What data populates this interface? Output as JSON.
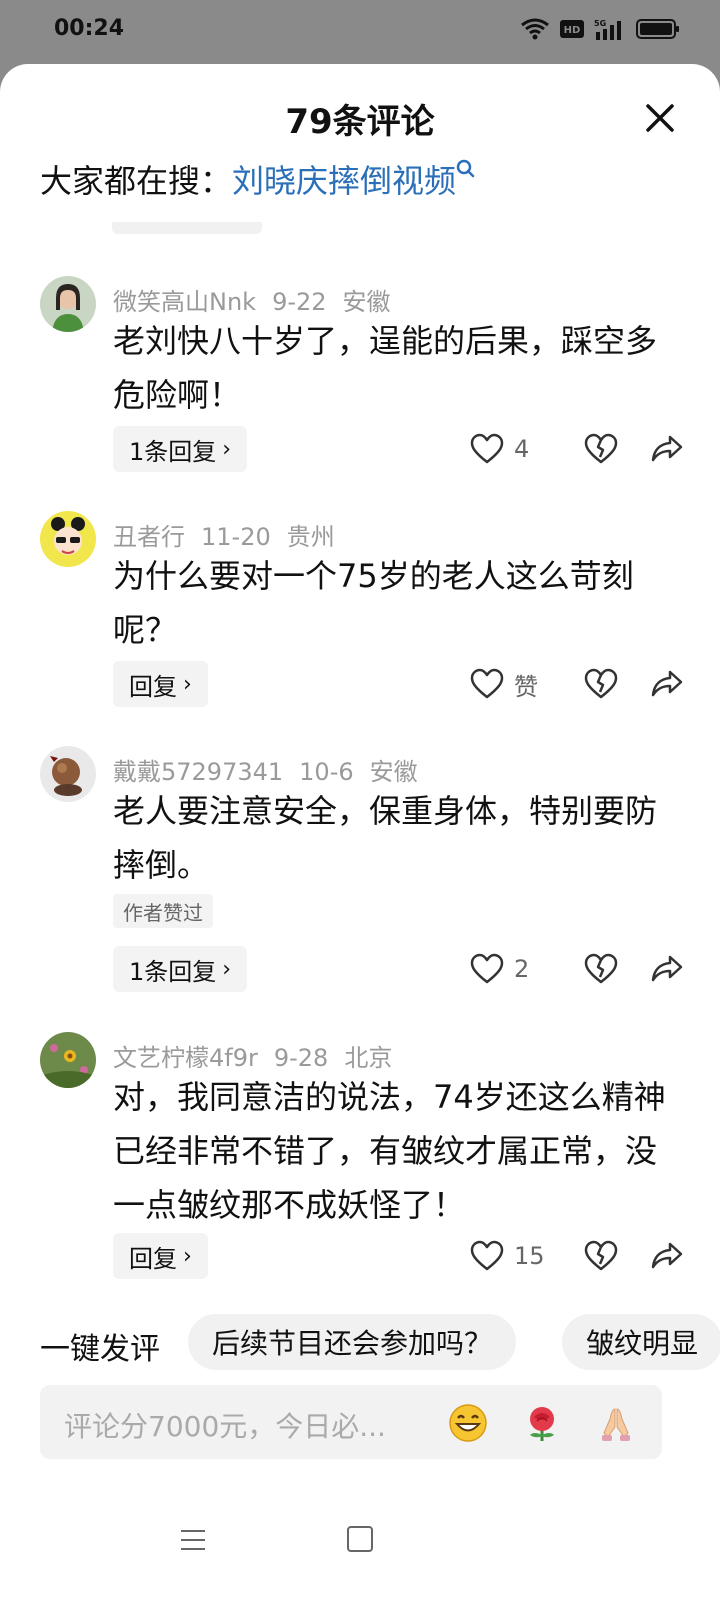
{
  "status": {
    "time": "00:24"
  },
  "sheet": {
    "title": "79条评论"
  },
  "search": {
    "label": "大家都在搜：",
    "query": "刘晓庆摔倒视频"
  },
  "comments": [
    {
      "user": "微笑高山Nnk",
      "date": "9-22",
      "location": "安徽",
      "text": "老刘快八十岁了，逞能的后果，踩空多危险啊！",
      "reply_label": "1条回复",
      "like_count": "4"
    },
    {
      "user": "丑者行",
      "date": "11-20",
      "location": "贵州",
      "text": "为什么要对一个75岁的老人这么苛刻呢？",
      "reply_label": "回复",
      "like_count": "赞"
    },
    {
      "user": "戴戴57297341",
      "date": "10-6",
      "location": "安徽",
      "text": "老人要注意安全，保重身体，特别要防摔倒。",
      "author_tag": "作者赞过",
      "reply_label": "1条回复",
      "like_count": "2"
    },
    {
      "user": "文艺柠檬4f9r",
      "date": "9-28",
      "location": "北京",
      "text": "对，我同意洁的说法，74岁还这么精神已经非常不错了，有皱纹才属正常，没一点皱纹那不成妖怪了！",
      "reply_label": "回复",
      "like_count": "15"
    }
  ],
  "quick_comments": {
    "label": "一键发评",
    "chips": [
      "后续节目还会参加吗？",
      "皱纹明显"
    ]
  },
  "input": {
    "placeholder": "评论分7000元，今日必..."
  },
  "icons": {
    "close": "close-icon",
    "search": "search-icon",
    "like": "heart-icon",
    "dislike": "broken-heart-icon",
    "share": "share-icon",
    "emoji_grin": "grin-emoji-icon",
    "emoji_rose": "rose-emoji-icon",
    "emoji_pray": "pray-emoji-icon"
  },
  "colors": {
    "link": "#2a6fb8",
    "background": "#ffffff",
    "chip": "#f1f1f1"
  }
}
